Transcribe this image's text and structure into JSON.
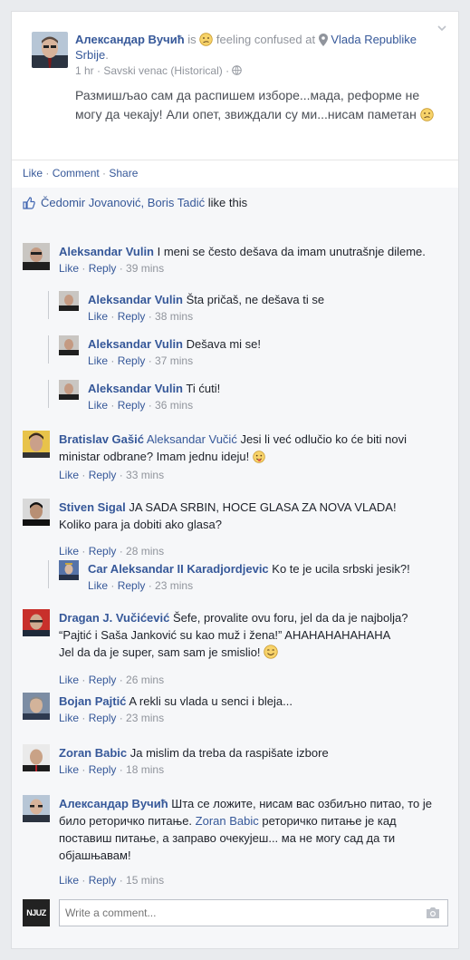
{
  "post": {
    "author": "Александар Вучић",
    "is_text": "is",
    "feeling": "feeling confused",
    "at_text": "at",
    "place": "Vlada Republike Srbije",
    "trailing_dot": ".",
    "time": "1 hr",
    "sep": " · ",
    "location": "Savski venac (Historical)",
    "sep2": " · ",
    "text": "Размишљао сам да распишем изборе...мада, реформе не могу да чекају! Али опет, звиждали су ми...нисам паметан"
  },
  "actions": {
    "like": "Like",
    "comment": "Comment",
    "share": "Share",
    "sep": " · "
  },
  "likes": {
    "names": "Čedomir Jovanović, Boris Tadić",
    "suffix": " like this"
  },
  "comment_actions": {
    "like": "Like",
    "reply": "Reply",
    "sep": " · "
  },
  "comments": [
    {
      "author": "Aleksandar Vulin",
      "text": "I meni se često dešava da imam unutrašnje dileme.",
      "time": "39 mins"
    },
    {
      "author": "Aleksandar Vulin",
      "text": "Šta pričaš, ne dešava ti se",
      "time": "38 mins"
    },
    {
      "author": "Aleksandar Vulin",
      "text": "Dešava mi se!",
      "time": "37 mins"
    },
    {
      "author": "Aleksandar Vulin",
      "text": "Ti ćuti!",
      "time": "36 mins"
    },
    {
      "author": "Bratislav Gašić",
      "mention": "Aleksandar Vučić",
      "text": "Jesi li već odlučio ko će biti novi ministar odbrane? Imam jednu ideju!",
      "time": "33 mins"
    },
    {
      "author": "Stiven Sigal",
      "text": "JA SADA SRBIN, HOCE GLASA ZA NOVA VLADA! Koliko para ja dobiti ako glasa?",
      "time": "28 mins"
    },
    {
      "author": "Car Aleksandar II Karadjordjevic",
      "text": "Ko te je ucila srbski jesik?!",
      "time": "23 mins"
    },
    {
      "author": "Dragan J. Vučićević",
      "text_line1": "Šefe, provalite ovu foru, jel da da je najbolja?",
      "text_line2": "“Pajtić i Saša Janković su kao muž i žena!” AHAHAHAHAHAHA",
      "text_line3": "Jel da da je super, sam sam je smislio!",
      "time": "26 mins"
    },
    {
      "author": "Bojan Pajtić",
      "text": "A rekli su vlada u senci i bleja...",
      "time": "23 mins"
    },
    {
      "author": "Zoran Babic",
      "text": "Ja mislim da treba da raspišate izbore",
      "time": "18 mins"
    },
    {
      "author": "Александар Вучић",
      "text_part1": "Шта се ложите, нисам вас озбиљно питао, то је било реторичко питање.",
      "mention": "Zoran Babic",
      "text_part2": "реторичко питање је кад поставиш питање, а заправо очекујеш... ма не могу сад да ти објашњавам!",
      "time": "15 mins"
    }
  ],
  "composer": {
    "placeholder": "Write a comment...",
    "avatar_text": "NJUZ"
  }
}
